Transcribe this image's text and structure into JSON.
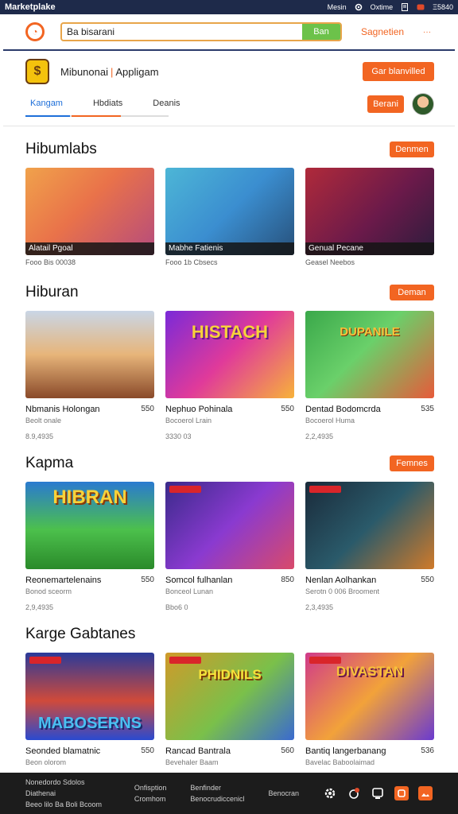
{
  "topbar": {
    "brand": "Marketplake",
    "links": [
      "Mesin",
      "Oxtime",
      "Ξ5840"
    ]
  },
  "search": {
    "value": "Ba bisarani",
    "button": "Ban",
    "extra": "Sagnetien",
    "more": "···"
  },
  "header": {
    "title": "Mibunonai",
    "subtitle": "Appligam",
    "cta": "Gar blanvilled"
  },
  "tabs": [
    {
      "label": "Kangam"
    },
    {
      "label": "Hbdiats"
    },
    {
      "label": "Deanis"
    }
  ],
  "tab_button": "Berani",
  "colors": {
    "accent": "#f26522",
    "nav": "#1e2a4a",
    "active_tab": "#1e6fd9",
    "go_button": "#6cc24a"
  },
  "sections": [
    {
      "title": "Hibumlabs",
      "button": "Denmen",
      "cards": [
        {
          "caption": "Alatail Pgoal",
          "sub": "Fooo Bis 00038"
        },
        {
          "caption": "Mabhe Fatienis",
          "sub": "Fooo 1b Cbsecs"
        },
        {
          "caption": "Genual Pecane",
          "sub": "Geasel Neebos"
        }
      ]
    },
    {
      "title": "Hiburan",
      "button": "Deman",
      "cards": [
        {
          "name": "Nbmanis Holongan",
          "price": "550",
          "dev": "Beolt onale",
          "size": "8.9,4935",
          "art": ""
        },
        {
          "name": "Nephuo Pohinala",
          "price": "550",
          "dev": "Bocoerol Lrain",
          "size": "3330 03",
          "art": "HISTACH"
        },
        {
          "name": "Dentad Bodomcrda",
          "price": "535",
          "dev": "Bocoerol Huma",
          "size": "2,2,4935",
          "art": "DUPANILE"
        }
      ]
    },
    {
      "title": "Kapma",
      "button": "Femnes",
      "cards": [
        {
          "name": "Reonemartelenains",
          "price": "550",
          "dev": "Bonod sceorm",
          "size": "2,9,4935",
          "art": "HIBRAN"
        },
        {
          "name": "Somcol fulhanlan",
          "price": "850",
          "dev": "Bonceol Lunan",
          "size": "Bbo6 0",
          "art": ""
        },
        {
          "name": "Nenlan Aolhankan",
          "price": "550",
          "dev": "Serotn 0 006 Brooment",
          "size": "2,3,4935",
          "art": ""
        }
      ]
    },
    {
      "title": "Karge Gabtanes",
      "button": "",
      "cards": [
        {
          "name": "Seonded blamatnic",
          "price": "550",
          "dev": "Beon olorom",
          "art": "MABOSERNS"
        },
        {
          "name": "Rancad Bantrala",
          "price": "560",
          "dev": "Bevehaler Baam",
          "art": "PHIDNILS"
        },
        {
          "name": "Bantiq langerbanang",
          "price": "536",
          "dev": "Bavelac Baboolaimad",
          "art": "DIVASTAN"
        }
      ]
    }
  ],
  "footer": {
    "columns": [
      {
        "line1": "Nonedordo Sdolos Diathenai",
        "line2": "Beeo lilo Ba Boli Bcoom"
      },
      {
        "line1": "Onfisption",
        "line2": "Cromhom"
      },
      {
        "line1": "Benfinder",
        "line2": "Benocrudiccenicl"
      },
      {
        "line1": "Benocran",
        "line2": ""
      }
    ]
  }
}
